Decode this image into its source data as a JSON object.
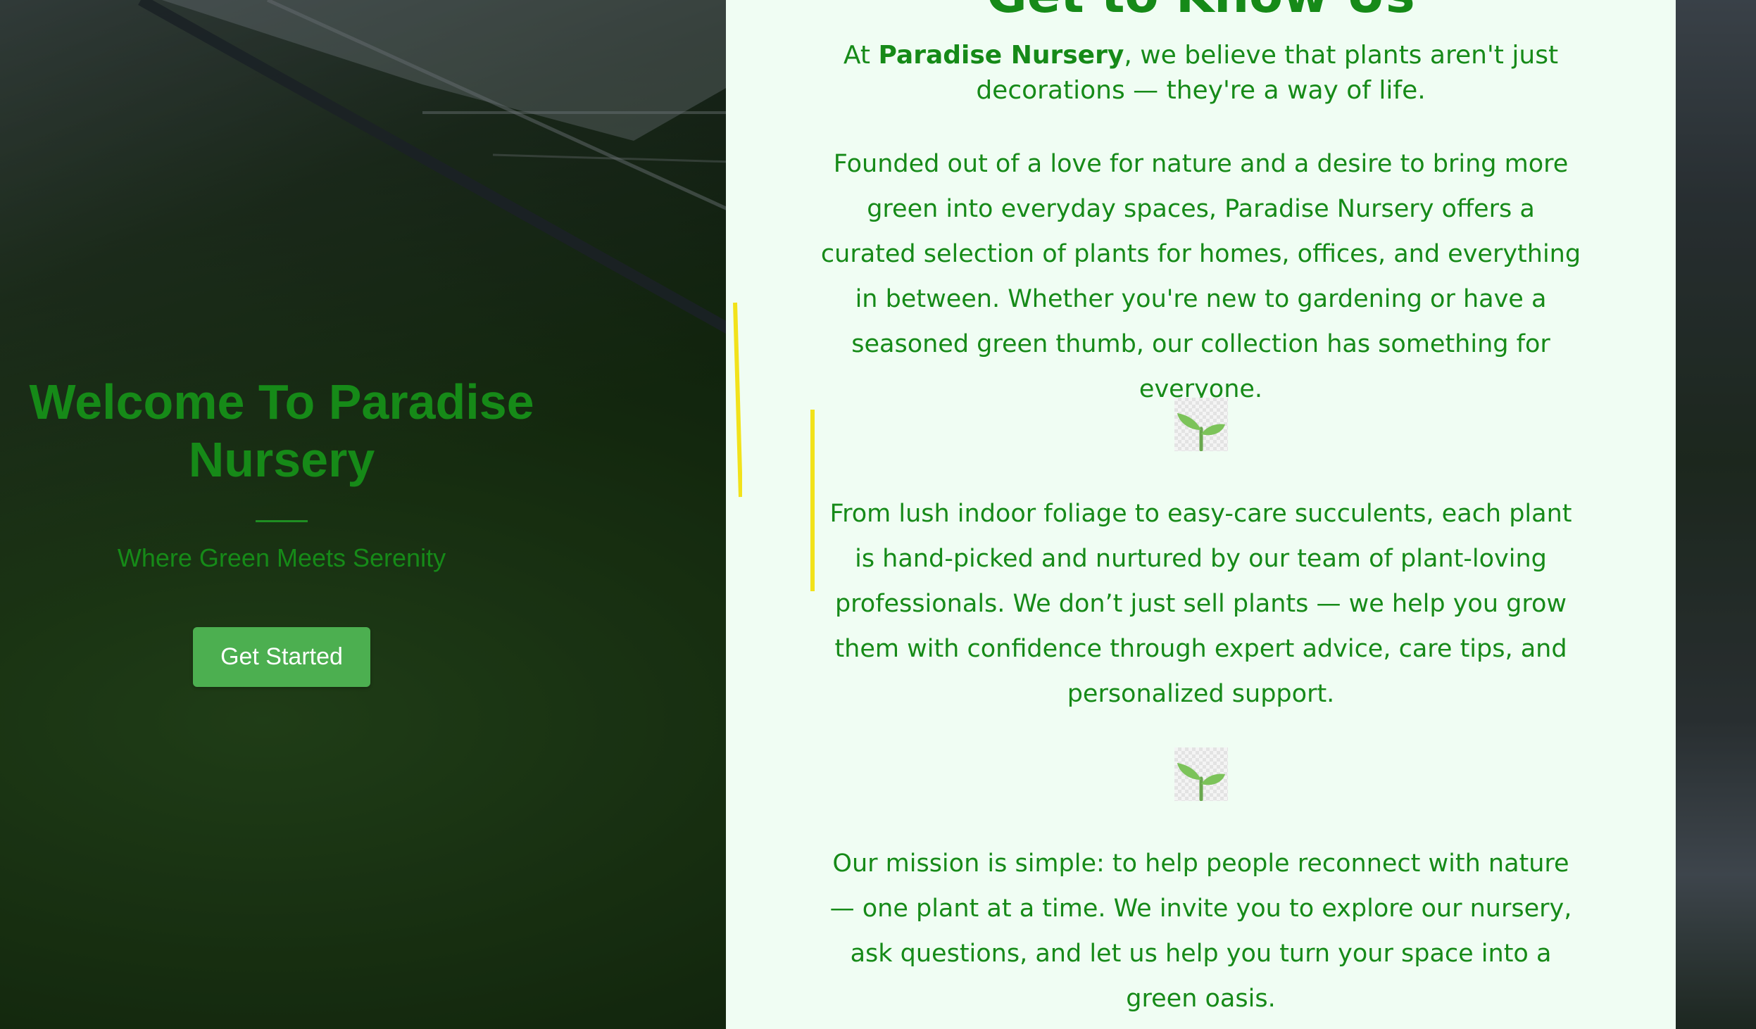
{
  "hero": {
    "title": "Welcome To Paradise Nursery",
    "tagline": "Where Green Meets Serenity",
    "button_label": "Get Started"
  },
  "about": {
    "title": "Get to Know Us",
    "intro_prefix": "At ",
    "intro_brand": "Paradise Nursery",
    "intro_suffix": ", we believe that plants aren't just decorations — they're a way of life.",
    "paragraph_1": "Founded out of a love for nature and a desire to bring more green into everyday spaces, Paradise Nursery offers a curated selection of plants for homes, offices, and everything in between. Whether you're new to gardening or have a seasoned green thumb, our collection has something for everyone.",
    "paragraph_2": "From lush indoor foliage to easy-care succulents, each plant is hand-picked and nurtured by our team of plant-loving professionals. We don’t just sell plants — we help you grow them with confidence through expert advice, care tips, and personalized support.",
    "paragraph_3": "Our mission is simple: to help people reconnect with nature — one plant at a time. We invite you to explore our nursery, ask questions, and let us help you turn your space into a green oasis.",
    "divider_icon": "seedling-icon"
  },
  "colors": {
    "text_green": "#168a18",
    "button_green": "#4caf50",
    "panel_bg": "#f0fdf3",
    "highlight_yellow": "#f2e21a"
  }
}
